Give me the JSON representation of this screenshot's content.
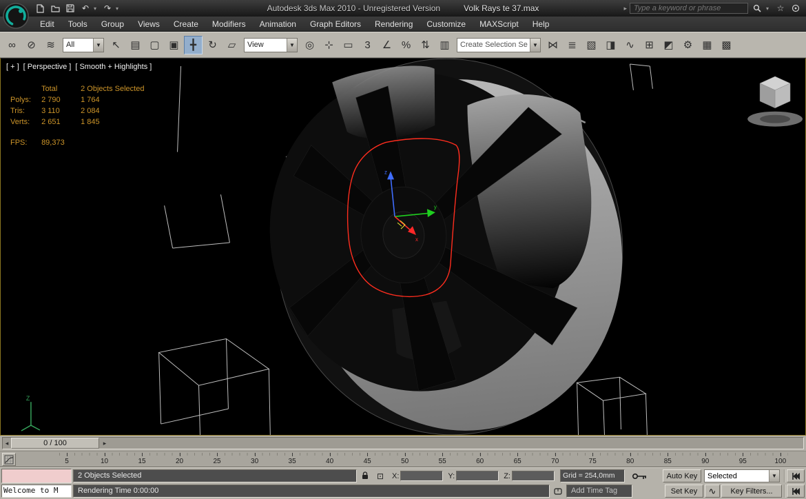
{
  "title_bar": {
    "app_title": "Autodesk 3ds Max 2010  - Unregistered Version",
    "doc_title": "Volk Rays te 37.max",
    "search_placeholder": "Type a keyword or phrase"
  },
  "menu_bar": {
    "items": [
      "Edit",
      "Tools",
      "Group",
      "Views",
      "Create",
      "Modifiers",
      "Animation",
      "Graph Editors",
      "Rendering",
      "Customize",
      "MAXScript",
      "Help"
    ]
  },
  "toolbar": {
    "selection_filter_value": "All",
    "coord_system_value": "View",
    "named_selection_value": "Create Selection Se",
    "group_link": [
      {
        "name": "select-and-link-button",
        "glyph": "∞"
      },
      {
        "name": "unlink-selection-button",
        "glyph": "⊘"
      },
      {
        "name": "bind-to-space-warp-button",
        "glyph": "≋"
      }
    ],
    "group_select": [
      {
        "name": "select-object-button",
        "glyph": "↖"
      },
      {
        "name": "select-by-name-button",
        "glyph": "▤"
      },
      {
        "name": "rectangular-selection-region-button",
        "glyph": "▢"
      },
      {
        "name": "window-crossing-toggle-button",
        "glyph": "▣"
      }
    ],
    "group_transform": [
      {
        "name": "select-and-move-button",
        "glyph": "╋",
        "active": true
      },
      {
        "name": "select-and-rotate-button",
        "glyph": "↻"
      },
      {
        "name": "select-and-scale-button",
        "glyph": "▱"
      }
    ],
    "group_pivot_snaps": [
      {
        "name": "use-pivot-point-center-button",
        "glyph": "◎"
      },
      {
        "name": "select-and-manipulate-button",
        "glyph": "⊹"
      },
      {
        "name": "keyboard-shortcut-override-button",
        "glyph": "▭"
      },
      {
        "name": "snap-toggle-3d-button",
        "glyph": "3"
      },
      {
        "name": "angle-snap-toggle-button",
        "glyph": "∠"
      },
      {
        "name": "percent-snap-toggle-button",
        "glyph": "%"
      },
      {
        "name": "spinner-snap-toggle-button",
        "glyph": "⇅"
      },
      {
        "name": "edit-named-selection-sets-button",
        "glyph": "▥"
      }
    ],
    "group_mirror_align": [
      {
        "name": "mirror-button",
        "glyph": "⋈"
      },
      {
        "name": "align-button",
        "glyph": "≣"
      }
    ],
    "group_editors": [
      {
        "name": "layer-manager-button",
        "glyph": "▧"
      },
      {
        "name": "graphite-modeling-tools-button",
        "glyph": "◨"
      },
      {
        "name": "curve-editor-button",
        "glyph": "∿"
      },
      {
        "name": "schematic-view-button",
        "glyph": "⊞"
      },
      {
        "name": "material-editor-button",
        "glyph": "◩"
      },
      {
        "name": "render-setup-button",
        "glyph": "⚙"
      },
      {
        "name": "rendered-frame-window-button",
        "glyph": "▦"
      },
      {
        "name": "render-production-button",
        "glyph": "▩"
      }
    ]
  },
  "viewport": {
    "label_general": "[ + ]",
    "label_view": "[ Perspective ]",
    "label_shading": "[ Smooth + Highlights ]",
    "stats": {
      "header_total": "Total",
      "header_selected": "2 Objects Selected",
      "rows": [
        {
          "label": "Polys:",
          "total": "2 790",
          "selected": "1 764"
        },
        {
          "label": "Tris:",
          "total": "3 110",
          "selected": "2 084"
        },
        {
          "label": "Verts:",
          "total": "2 651",
          "selected": "1 845"
        }
      ],
      "fps_label": "FPS:",
      "fps_value": "89,373"
    },
    "gizmo": {
      "x_label": "x",
      "y_label": "y",
      "z_label": "z"
    },
    "world_axis_label": "Z"
  },
  "timeline": {
    "slider_label": "0 / 100",
    "ticks": [
      "5",
      "10",
      "15",
      "20",
      "25",
      "30",
      "35",
      "40",
      "45",
      "50",
      "55",
      "60",
      "65",
      "70",
      "75",
      "80",
      "85",
      "90",
      "95",
      "100"
    ]
  },
  "status_bar": {
    "listener_line": "Welcome to M",
    "prompt": "2 Objects Selected",
    "status_line": "Rendering Time  0:00:00",
    "x_label": "X:",
    "y_label": "Y:",
    "z_label": "Z:",
    "grid_value": "Grid = 254,0mm",
    "auto_key_label": "Auto Key",
    "set_key_label": "Set Key",
    "selected_combo_value": "Selected",
    "key_filters_label": "Key Filters...",
    "add_time_tag_label": "Add Time Tag"
  },
  "colors": {
    "viewport_border": "#8a7620",
    "stats_text": "#cc9429",
    "selection_outline": "#ff2d1e",
    "active_tool_highlight": "#93aecc"
  }
}
